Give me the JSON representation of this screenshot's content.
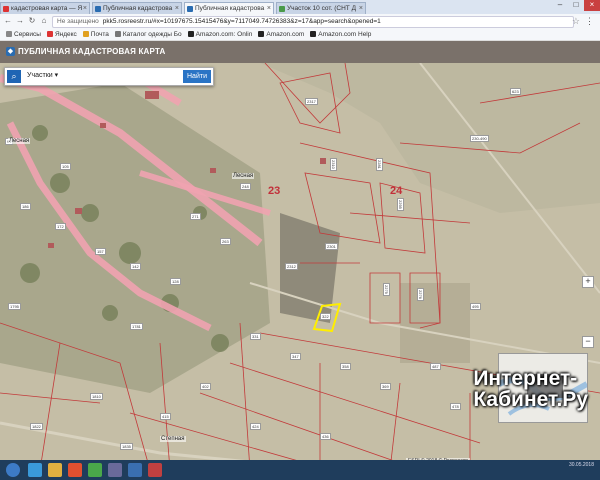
{
  "browser": {
    "tabs": [
      {
        "label": "кадастровая карта — Я",
        "active": false
      },
      {
        "label": "Публичная кадастрова",
        "active": false
      },
      {
        "label": "Публичная кадастрова",
        "active": true
      },
      {
        "label": "Участок 10 сот. (СНТ Д",
        "active": false
      }
    ],
    "security": "Не защищено",
    "url": "pkk5.rosreestr.ru/#x=10197675.15415476&y=7117049.74726383&z=17&app=search&opened=1",
    "bookmarks": [
      "Сервисы",
      "Яндекс",
      "Почта",
      "Каталог одежды Бо",
      "Amazon.com: Onlin",
      "Amazon.com",
      "Amazon.com Help"
    ]
  },
  "pkk": {
    "title": "ПУБЛИЧНАЯ КАДАСТРОВАЯ КАРТА",
    "search_select": "Участки",
    "search_placeholder": "",
    "search_button": "Найти"
  },
  "map": {
    "quarter_numbers": [
      "23",
      "24"
    ],
    "streets": [
      "Лесная",
      "Лесная",
      "Степная"
    ],
    "attribution": "ESRI © 2018 © Росреестр"
  },
  "watermark": {
    "line1": "Интернет-",
    "line2": "Кабинет.Ру"
  },
  "taskbar": {
    "date": "30.05.2018"
  }
}
